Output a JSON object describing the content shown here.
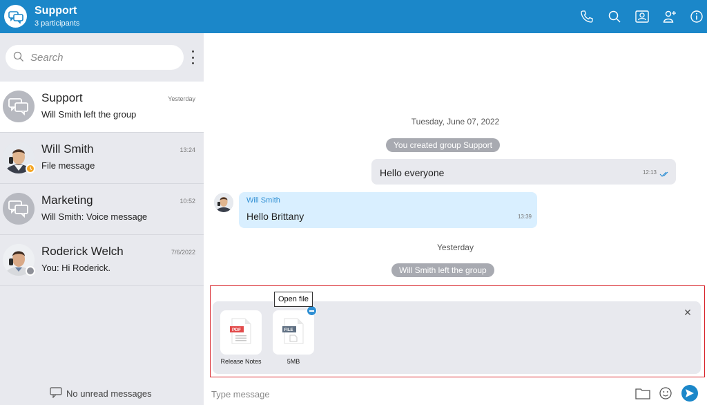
{
  "header": {
    "title": "Support",
    "subtitle": "3 participants",
    "icons": [
      "phone-icon",
      "search-icon",
      "contact-card-icon",
      "add-user-icon",
      "info-icon"
    ]
  },
  "sidebar": {
    "search_placeholder": "Search",
    "conversations": [
      {
        "name": "Support",
        "preview": "Will Smith left the group",
        "time": "Yesterday",
        "avatar": "group-chat-icon",
        "active": true
      },
      {
        "name": "Will Smith",
        "preview": "File message",
        "time": "13:24",
        "avatar": "person-photo",
        "status": "away"
      },
      {
        "name": "Marketing",
        "preview": "Will Smith: Voice message",
        "time": "10:52",
        "avatar": "group-chat-icon"
      },
      {
        "name": "Roderick Welch",
        "preview": "You: Hi Roderick.",
        "time": "7/6/2022",
        "avatar": "person-photo",
        "status": "offline"
      }
    ],
    "footer": "No unread messages"
  },
  "chat": {
    "date1": "Tuesday, June 07, 2022",
    "system1": "You created group Support",
    "outgoing": {
      "text": "Hello everyone",
      "time": "12:13"
    },
    "incoming": {
      "sender": "Will Smith",
      "text": "Hello Brittany",
      "time": "13:39"
    },
    "date2": "Yesterday",
    "system2": "Will Smith left the group"
  },
  "attachments": {
    "tooltip": "Open file",
    "files": [
      {
        "label": "Release Notes",
        "type": "PDF"
      },
      {
        "label": "5MB",
        "type": "FILE"
      }
    ]
  },
  "composer": {
    "placeholder": "Type message"
  },
  "colors": {
    "brand": "#1b87c9",
    "sidebar_bg": "#e8e9ee",
    "incoming_bubble": "#d9efff",
    "away_status": "#f5a623",
    "offline_status": "#8e9098",
    "highlight_outline": "#d8232a"
  }
}
